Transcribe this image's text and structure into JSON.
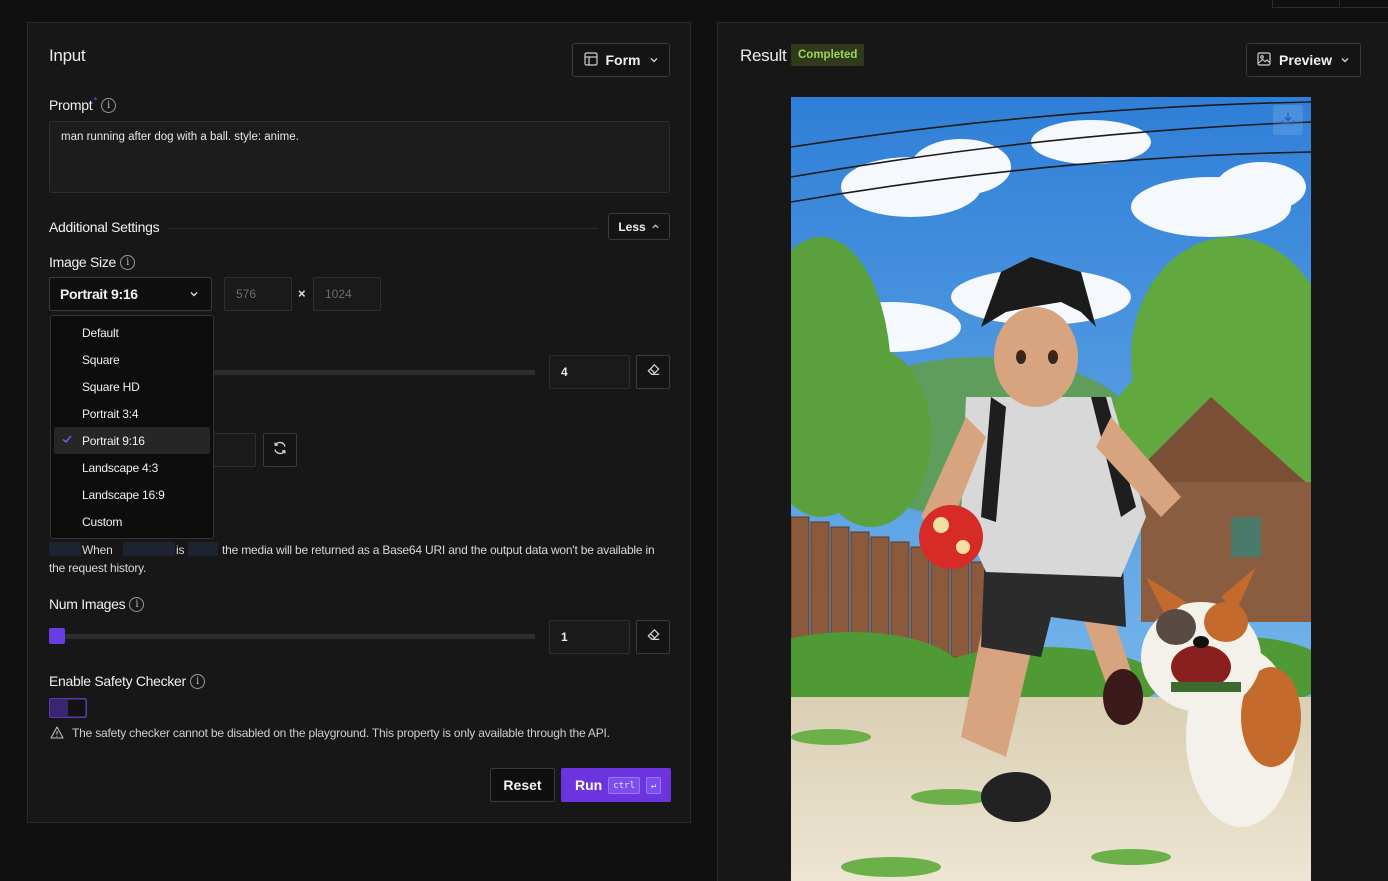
{
  "input_panel": {
    "title": "Input",
    "form_button": "Form",
    "prompt": {
      "label": "Prompt",
      "required_mark": "*",
      "value": "man running after dog  with a ball. style: anime."
    },
    "additional_settings": {
      "label": "Additional Settings",
      "toggle_label": "Less"
    },
    "image_size": {
      "label": "Image Size",
      "selected": "Portrait 9:16",
      "width_placeholder": "576",
      "height_placeholder": "1024",
      "times_symbol": "×",
      "options": [
        {
          "label": "Default",
          "selected": false
        },
        {
          "label": "Square",
          "selected": false
        },
        {
          "label": "Square HD",
          "selected": false
        },
        {
          "label": "Portrait 3:4",
          "selected": false
        },
        {
          "label": "Portrait 9:16",
          "selected": true
        },
        {
          "label": "Landscape 4:3",
          "selected": false
        },
        {
          "label": "Landscape 16:9",
          "selected": false
        },
        {
          "label": "Custom",
          "selected": false
        }
      ]
    },
    "steps_value": "4",
    "sync_note": {
      "part1": "When",
      "part2": "is",
      "part3": "the media will be returned as a Base64 URI and the output data won't be available in",
      "part4": "the request history."
    },
    "num_images": {
      "label": "Num Images",
      "value": "1",
      "slider_fraction": 0.0
    },
    "safety_checker": {
      "label": "Enable Safety Checker",
      "enabled": true,
      "warning": "The safety checker cannot be disabled on the playground. This property is only available through the API."
    },
    "reset_button": "Reset",
    "run_button": "Run",
    "shortcut_ctrl": "ctrl",
    "shortcut_enter": "↵"
  },
  "result_panel": {
    "title": "Result",
    "status_badge": "Completed",
    "preview_button": "Preview"
  },
  "colors": {
    "accent": "#6b34df",
    "completed_bg": "#2f3a1b",
    "completed_text": "#9fd45a"
  },
  "icons": {
    "form": "layout-icon",
    "preview": "image-icon",
    "chevron": "chevron-down-icon",
    "eraser": "eraser-icon",
    "refresh": "refresh-icon",
    "check": "check-icon",
    "warning": "warning-icon",
    "download": "download-icon",
    "info": "info-icon"
  }
}
